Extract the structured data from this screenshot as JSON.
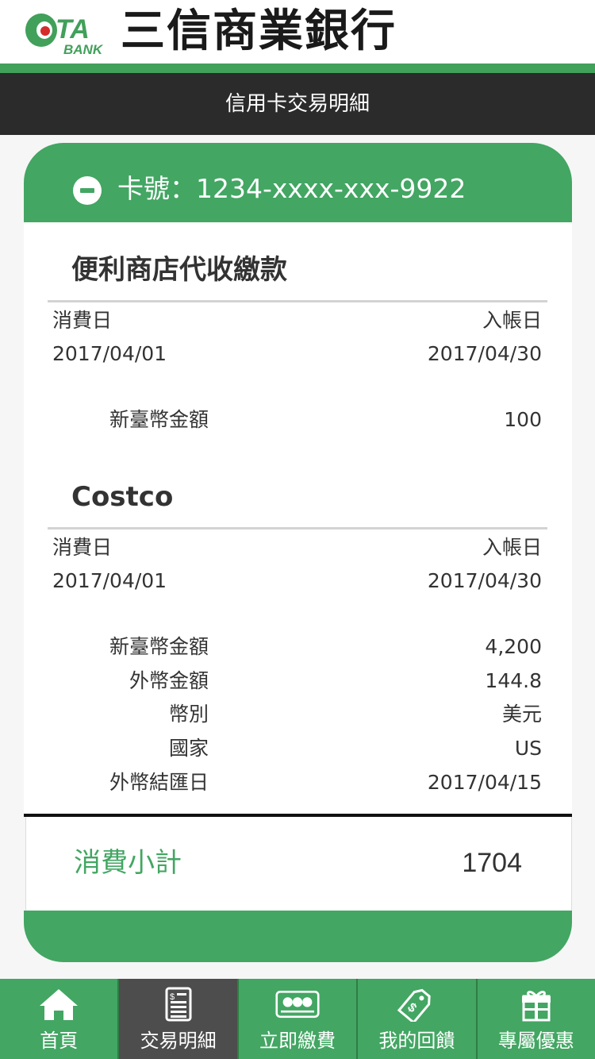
{
  "header": {
    "logo_text": "TA",
    "logo_sub": "BANK",
    "bank_name": "三信商業銀行",
    "page_title": "信用卡交易明細"
  },
  "colors": {
    "brand_green": "#43a663",
    "dark_bar": "#2b2b2b",
    "logo_red": "#d42b2b"
  },
  "card": {
    "title": "卡號：1234-xxxx-xxx-9922",
    "toggle_icon": "minus-circle-icon",
    "transactions": [
      {
        "name": "便利商店代收繳款",
        "spend_date_label": "消費日",
        "post_date_label": "入帳日",
        "spend_date": "2017/04/01",
        "post_date": "2017/04/30",
        "details": [
          {
            "label": "新臺幣金額",
            "value": "100"
          }
        ]
      },
      {
        "name": "Costco",
        "spend_date_label": "消費日",
        "post_date_label": "入帳日",
        "spend_date": "2017/04/01",
        "post_date": "2017/04/30",
        "details": [
          {
            "label": "新臺幣金額",
            "value": "4,200"
          },
          {
            "label": "外幣金額",
            "value": "144.8"
          },
          {
            "label": "幣別",
            "value": "美元"
          },
          {
            "label": "國家",
            "value": "US"
          },
          {
            "label": "外幣結匯日",
            "value": "2017/04/15"
          }
        ]
      }
    ],
    "subtotal_label": "消費小計",
    "subtotal_value": "1704"
  },
  "nav": {
    "items": [
      {
        "label": "首頁",
        "icon": "home-icon",
        "active": false
      },
      {
        "label": "交易明細",
        "icon": "statement-icon",
        "active": true
      },
      {
        "label": "立即繳費",
        "icon": "bill-payment-icon",
        "active": false
      },
      {
        "label": "我的回饋",
        "icon": "reward-tag-icon",
        "active": false
      },
      {
        "label": "專屬優惠",
        "icon": "gift-icon",
        "active": false
      }
    ]
  }
}
